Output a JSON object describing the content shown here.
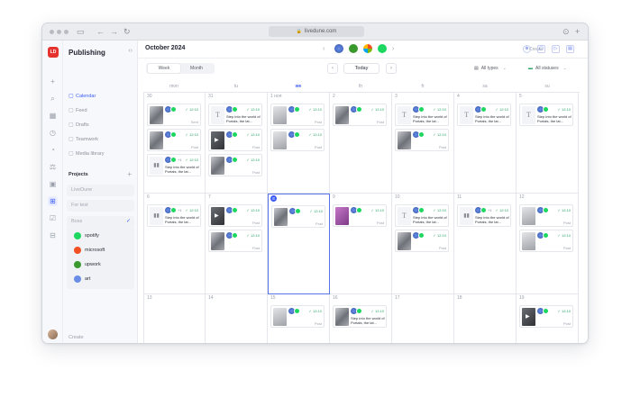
{
  "browser": {
    "url": "livedune.com"
  },
  "rail": {
    "logo": "LD"
  },
  "sidebar": {
    "title": "Publishing",
    "collapse_icon": "double-chevron-icon",
    "nav": [
      {
        "label": "Calendar",
        "icon": "calendar-icon",
        "active": true
      },
      {
        "label": "Feed",
        "icon": "feed-icon",
        "active": false
      },
      {
        "label": "Drafts",
        "icon": "drafts-icon",
        "active": false
      },
      {
        "label": "Teamwork",
        "icon": "teamwork-icon",
        "active": false
      },
      {
        "label": "Media library",
        "icon": "folder-icon",
        "active": false
      }
    ],
    "projects_label": "Projects",
    "projects": [
      "LiveDune",
      "For test",
      "Boss"
    ],
    "accounts": [
      {
        "name": "spotify",
        "color": "#1ed760"
      },
      {
        "name": "microsoft",
        "color": "#f25022"
      },
      {
        "name": "upwork",
        "color": "#3a9a2f"
      },
      {
        "name": "art",
        "color": "#6a8ee8"
      }
    ],
    "create_label": "Create"
  },
  "header": {
    "month": "October 2024",
    "create_label": "Create",
    "view_tabs": [
      "Week",
      "Month"
    ],
    "active_view": "Week",
    "today_label": "Today",
    "types_label": "All types",
    "statuses_label": "All statuses"
  },
  "days": [
    "mon",
    "tu",
    "we",
    "th",
    "fr",
    "sa",
    "su"
  ],
  "today_col": 2,
  "weeks": [
    {
      "dates": [
        "30",
        "31",
        "1 ноя",
        "2",
        "3",
        "4",
        "5"
      ]
    },
    {
      "dates": [
        "6",
        "7",
        "8",
        "9",
        "10",
        "11",
        "12"
      ]
    },
    {
      "dates": [
        "13",
        "14",
        "15",
        "16",
        "17",
        "18",
        "19"
      ]
    }
  ],
  "selected": {
    "week": 1,
    "col": 2
  },
  "post_text": "Step into the world of Portals, the lat...",
  "post_time": "12:10",
  "post_status_posted": "Post",
  "post_status_sent": "Sent",
  "post_extra": "+1",
  "posts": [
    {
      "w": 0,
      "c": 0,
      "slot": 0,
      "thumb": "photo",
      "status": "Sent",
      "text": false
    },
    {
      "w": 0,
      "c": 0,
      "slot": 1,
      "thumb": "photo",
      "status": "Post",
      "text": false
    },
    {
      "w": 0,
      "c": 0,
      "slot": 2,
      "thumb": "chart",
      "status": "",
      "text": true,
      "extra": true
    },
    {
      "w": 0,
      "c": 1,
      "slot": 0,
      "thumb": "text",
      "status": "",
      "text": true
    },
    {
      "w": 0,
      "c": 1,
      "slot": 1,
      "thumb": "dark",
      "status": "Post",
      "text": false
    },
    {
      "w": 0,
      "c": 1,
      "slot": 2,
      "thumb": "photo",
      "status": "Post",
      "text": false
    },
    {
      "w": 0,
      "c": 2,
      "slot": 0,
      "thumb": "gray",
      "status": "Post",
      "text": false
    },
    {
      "w": 0,
      "c": 2,
      "slot": 1,
      "thumb": "gray",
      "status": "Post",
      "text": false
    },
    {
      "w": 0,
      "c": 3,
      "slot": 0,
      "thumb": "photo",
      "status": "Post",
      "text": false
    },
    {
      "w": 0,
      "c": 4,
      "slot": 0,
      "thumb": "text",
      "status": "",
      "text": true
    },
    {
      "w": 0,
      "c": 4,
      "slot": 1,
      "thumb": "photo",
      "status": "Post",
      "text": false
    },
    {
      "w": 0,
      "c": 5,
      "slot": 0,
      "thumb": "text",
      "status": "",
      "text": true
    },
    {
      "w": 0,
      "c": 6,
      "slot": 0,
      "thumb": "text",
      "status": "",
      "text": true
    },
    {
      "w": 1,
      "c": 0,
      "slot": 0,
      "thumb": "chart",
      "status": "",
      "text": true,
      "extra": true
    },
    {
      "w": 1,
      "c": 1,
      "slot": 0,
      "thumb": "dark",
      "status": "Post",
      "text": false
    },
    {
      "w": 1,
      "c": 1,
      "slot": 1,
      "thumb": "photo",
      "status": "Post",
      "text": false
    },
    {
      "w": 1,
      "c": 2,
      "slot": 0,
      "thumb": "photo",
      "status": "Post",
      "text": false
    },
    {
      "w": 1,
      "c": 3,
      "slot": 0,
      "thumb": "purple",
      "status": "Post",
      "text": false
    },
    {
      "w": 1,
      "c": 4,
      "slot": 0,
      "thumb": "text",
      "status": "",
      "text": true
    },
    {
      "w": 1,
      "c": 4,
      "slot": 1,
      "thumb": "photo",
      "status": "Post",
      "text": false
    },
    {
      "w": 1,
      "c": 5,
      "slot": 0,
      "thumb": "chart",
      "status": "",
      "text": true,
      "extra": true
    },
    {
      "w": 1,
      "c": 6,
      "slot": 0,
      "thumb": "gray",
      "status": "Post",
      "text": false
    },
    {
      "w": 1,
      "c": 6,
      "slot": 1,
      "thumb": "gray",
      "status": "Post",
      "text": false
    },
    {
      "w": 2,
      "c": 2,
      "slot": 0,
      "thumb": "gray",
      "status": "Post",
      "text": false
    },
    {
      "w": 2,
      "c": 3,
      "slot": 0,
      "thumb": "photo",
      "status": "",
      "text": true
    },
    {
      "w": 2,
      "c": 6,
      "slot": 0,
      "thumb": "dark",
      "status": "Post",
      "text": false
    }
  ]
}
